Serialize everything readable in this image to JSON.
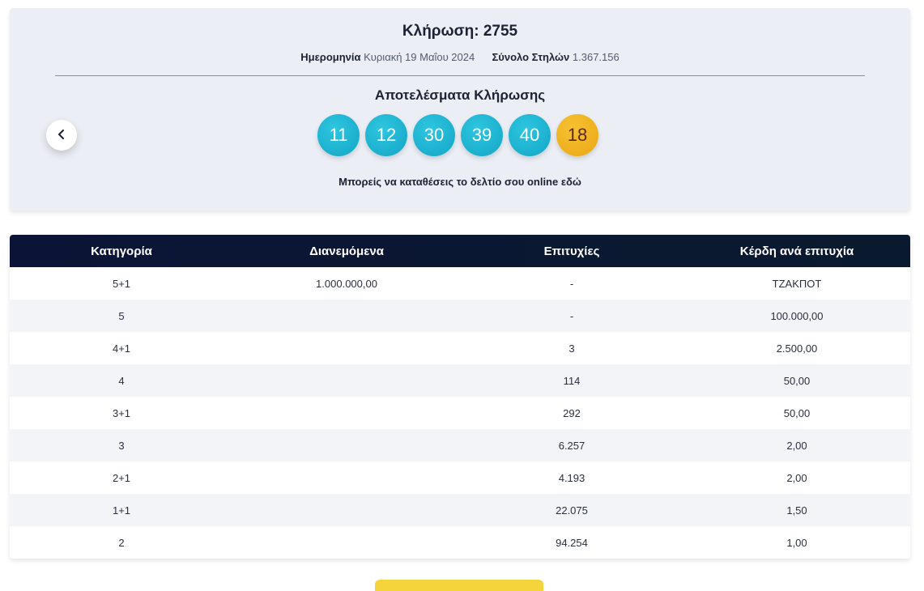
{
  "draw": {
    "title": "Κλήρωση: 2755",
    "date_label": "Ημερομηνία",
    "date_value": "Κυριακή 19 Μαΐου 2024",
    "columns_label": "Σύνολο Στηλών",
    "columns_value": "1.367.156",
    "results_title": "Αποτελέσματα Κλήρωσης",
    "numbers": [
      "11",
      "12",
      "30",
      "39",
      "40"
    ],
    "bonus": "18",
    "online_text": "Μπορείς να καταθέσεις το δελτίο σου online εδώ",
    "prev_icon": "chevron-left-icon"
  },
  "colors": {
    "main_ball": "#13a5c6",
    "bonus_ball": "#e9a614",
    "table_header": "#0b1436",
    "button": "#f4d43a"
  },
  "table": {
    "headers": [
      "Κατηγορία",
      "Διανεμόμενα",
      "Επιτυχίες",
      "Κέρδη ανά επιτυχία"
    ],
    "rows": [
      [
        "5+1",
        "1.000.000,00",
        "-",
        "ΤΖΑΚΠΟΤ"
      ],
      [
        "5",
        "",
        "-",
        "100.000,00"
      ],
      [
        "4+1",
        "",
        "3",
        "2.500,00"
      ],
      [
        "4",
        "",
        "114",
        "50,00"
      ],
      [
        "3+1",
        "",
        "292",
        "50,00"
      ],
      [
        "3",
        "",
        "6.257",
        "2,00"
      ],
      [
        "2+1",
        "",
        "4.193",
        "2,00"
      ],
      [
        "1+1",
        "",
        "22.075",
        "1,50"
      ],
      [
        "2",
        "",
        "94.254",
        "1,00"
      ]
    ]
  }
}
